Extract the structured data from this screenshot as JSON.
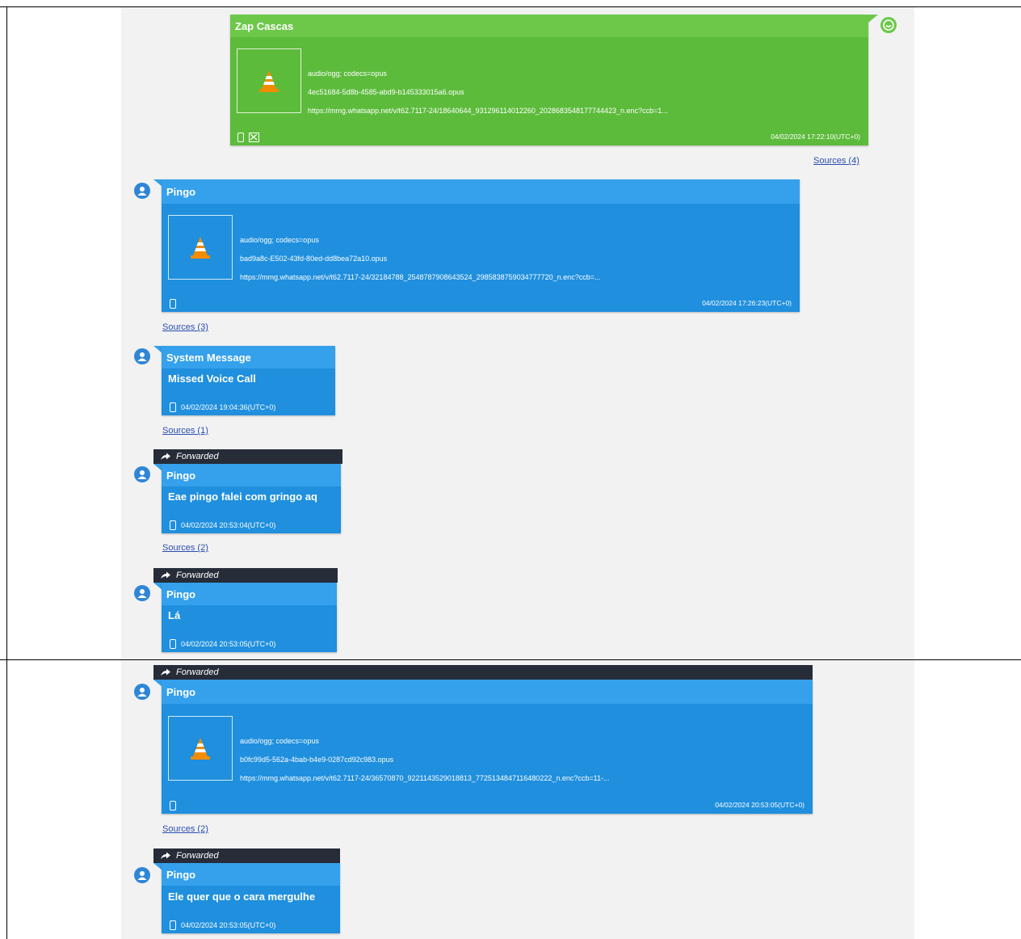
{
  "messages": [
    {
      "sender": "Zap Cascas",
      "mime": "audio/ogg; codecs=opus",
      "filename": "4ec51684-5d8b-4585-abd9-b145333015a6.opus",
      "url": "https://mmg.whatsapp.net/v/t62.7117-24/18640644_931296114012260_2028683548177744423_n.enc?ccb=1...",
      "timestamp": "04/02/2024 17:22:10(UTC+0)",
      "sources": "Sources (4)"
    },
    {
      "sender": "Pingo",
      "mime": "audio/ogg; codecs=opus",
      "filename": "bad9a8c-E502-43fd-80ed-dd8bea72a10.opus",
      "url": "https://mmg.whatsapp.net/v/t62.7117-24/32184788_2548787908643524_2985838759034777720_n.enc?ccb=...",
      "timestamp": "04/02/2024 17:26:23(UTC+0)",
      "sources": "Sources (3)"
    },
    {
      "sender": "System Message",
      "text": "Missed Voice Call",
      "timestamp": "04/02/2024 19:04:36(UTC+0)",
      "sources": "Sources (1)"
    },
    {
      "forwarded": "Forwarded",
      "sender": "Pingo",
      "text": "Eae pingo falei com gringo aq",
      "timestamp": "04/02/2024 20:53:04(UTC+0)",
      "sources": "Sources (2)"
    },
    {
      "forwarded": "Forwarded",
      "sender": "Pingo",
      "text": "Lá",
      "timestamp": "04/02/2024 20:53:05(UTC+0)"
    },
    {
      "forwarded": "Forwarded",
      "sender": "Pingo",
      "mime": "audio/ogg; codecs=opus",
      "filename": "b0fc99d5-562a-4bab-b4e9-0287cd92c983.opus",
      "url": "https://mmg.whatsapp.net/v/t62.7117-24/36570870_9221143529018813_7725134847116480222_n.enc?ccb=11-...",
      "timestamp": "04/02/2024 20:53:05(UTC+0)",
      "sources": "Sources (2)"
    },
    {
      "forwarded": "Forwarded",
      "sender": "Pingo",
      "text": "Ele quer que o cara mergulhe",
      "timestamp": "04/02/2024 20:53:05(UTC+0)"
    }
  ],
  "colors": {
    "outgoing": "#5dbb3c",
    "incoming": "#1f8fde",
    "forward_bar": "#262c38",
    "link": "#2a4db0"
  },
  "icons": [
    "vlc-cone-icon",
    "phone-icon",
    "mailbox-icon",
    "user-avatar-icon",
    "status-ok-icon",
    "forward-arrow-icon"
  ]
}
